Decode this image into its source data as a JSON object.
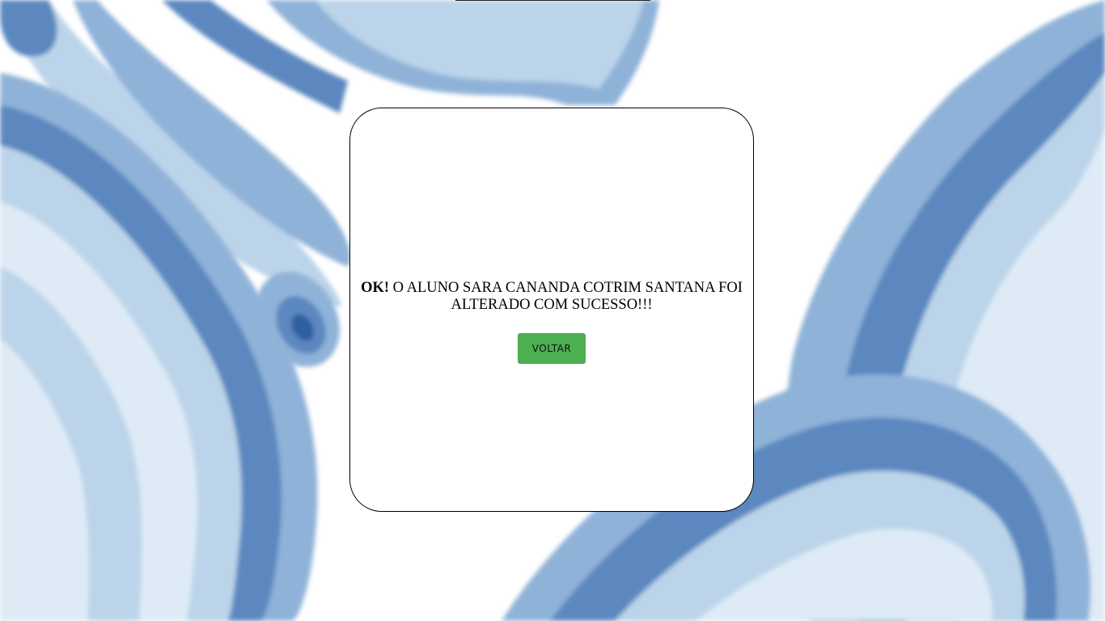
{
  "background": {
    "palette": [
      "#2f5f9e",
      "#5b88bf",
      "#8fb2d8",
      "#bcd4ea",
      "#deebf6",
      "#ffffff"
    ]
  },
  "dialog": {
    "status_strong": "OK!",
    "status_text": " O ALUNO SARA CANANDA COTRIM SANTANA FOI ALTERADO COM SUCESSO!!!",
    "back_button_label": "VOLTAR",
    "button_color": "#4caf50"
  }
}
